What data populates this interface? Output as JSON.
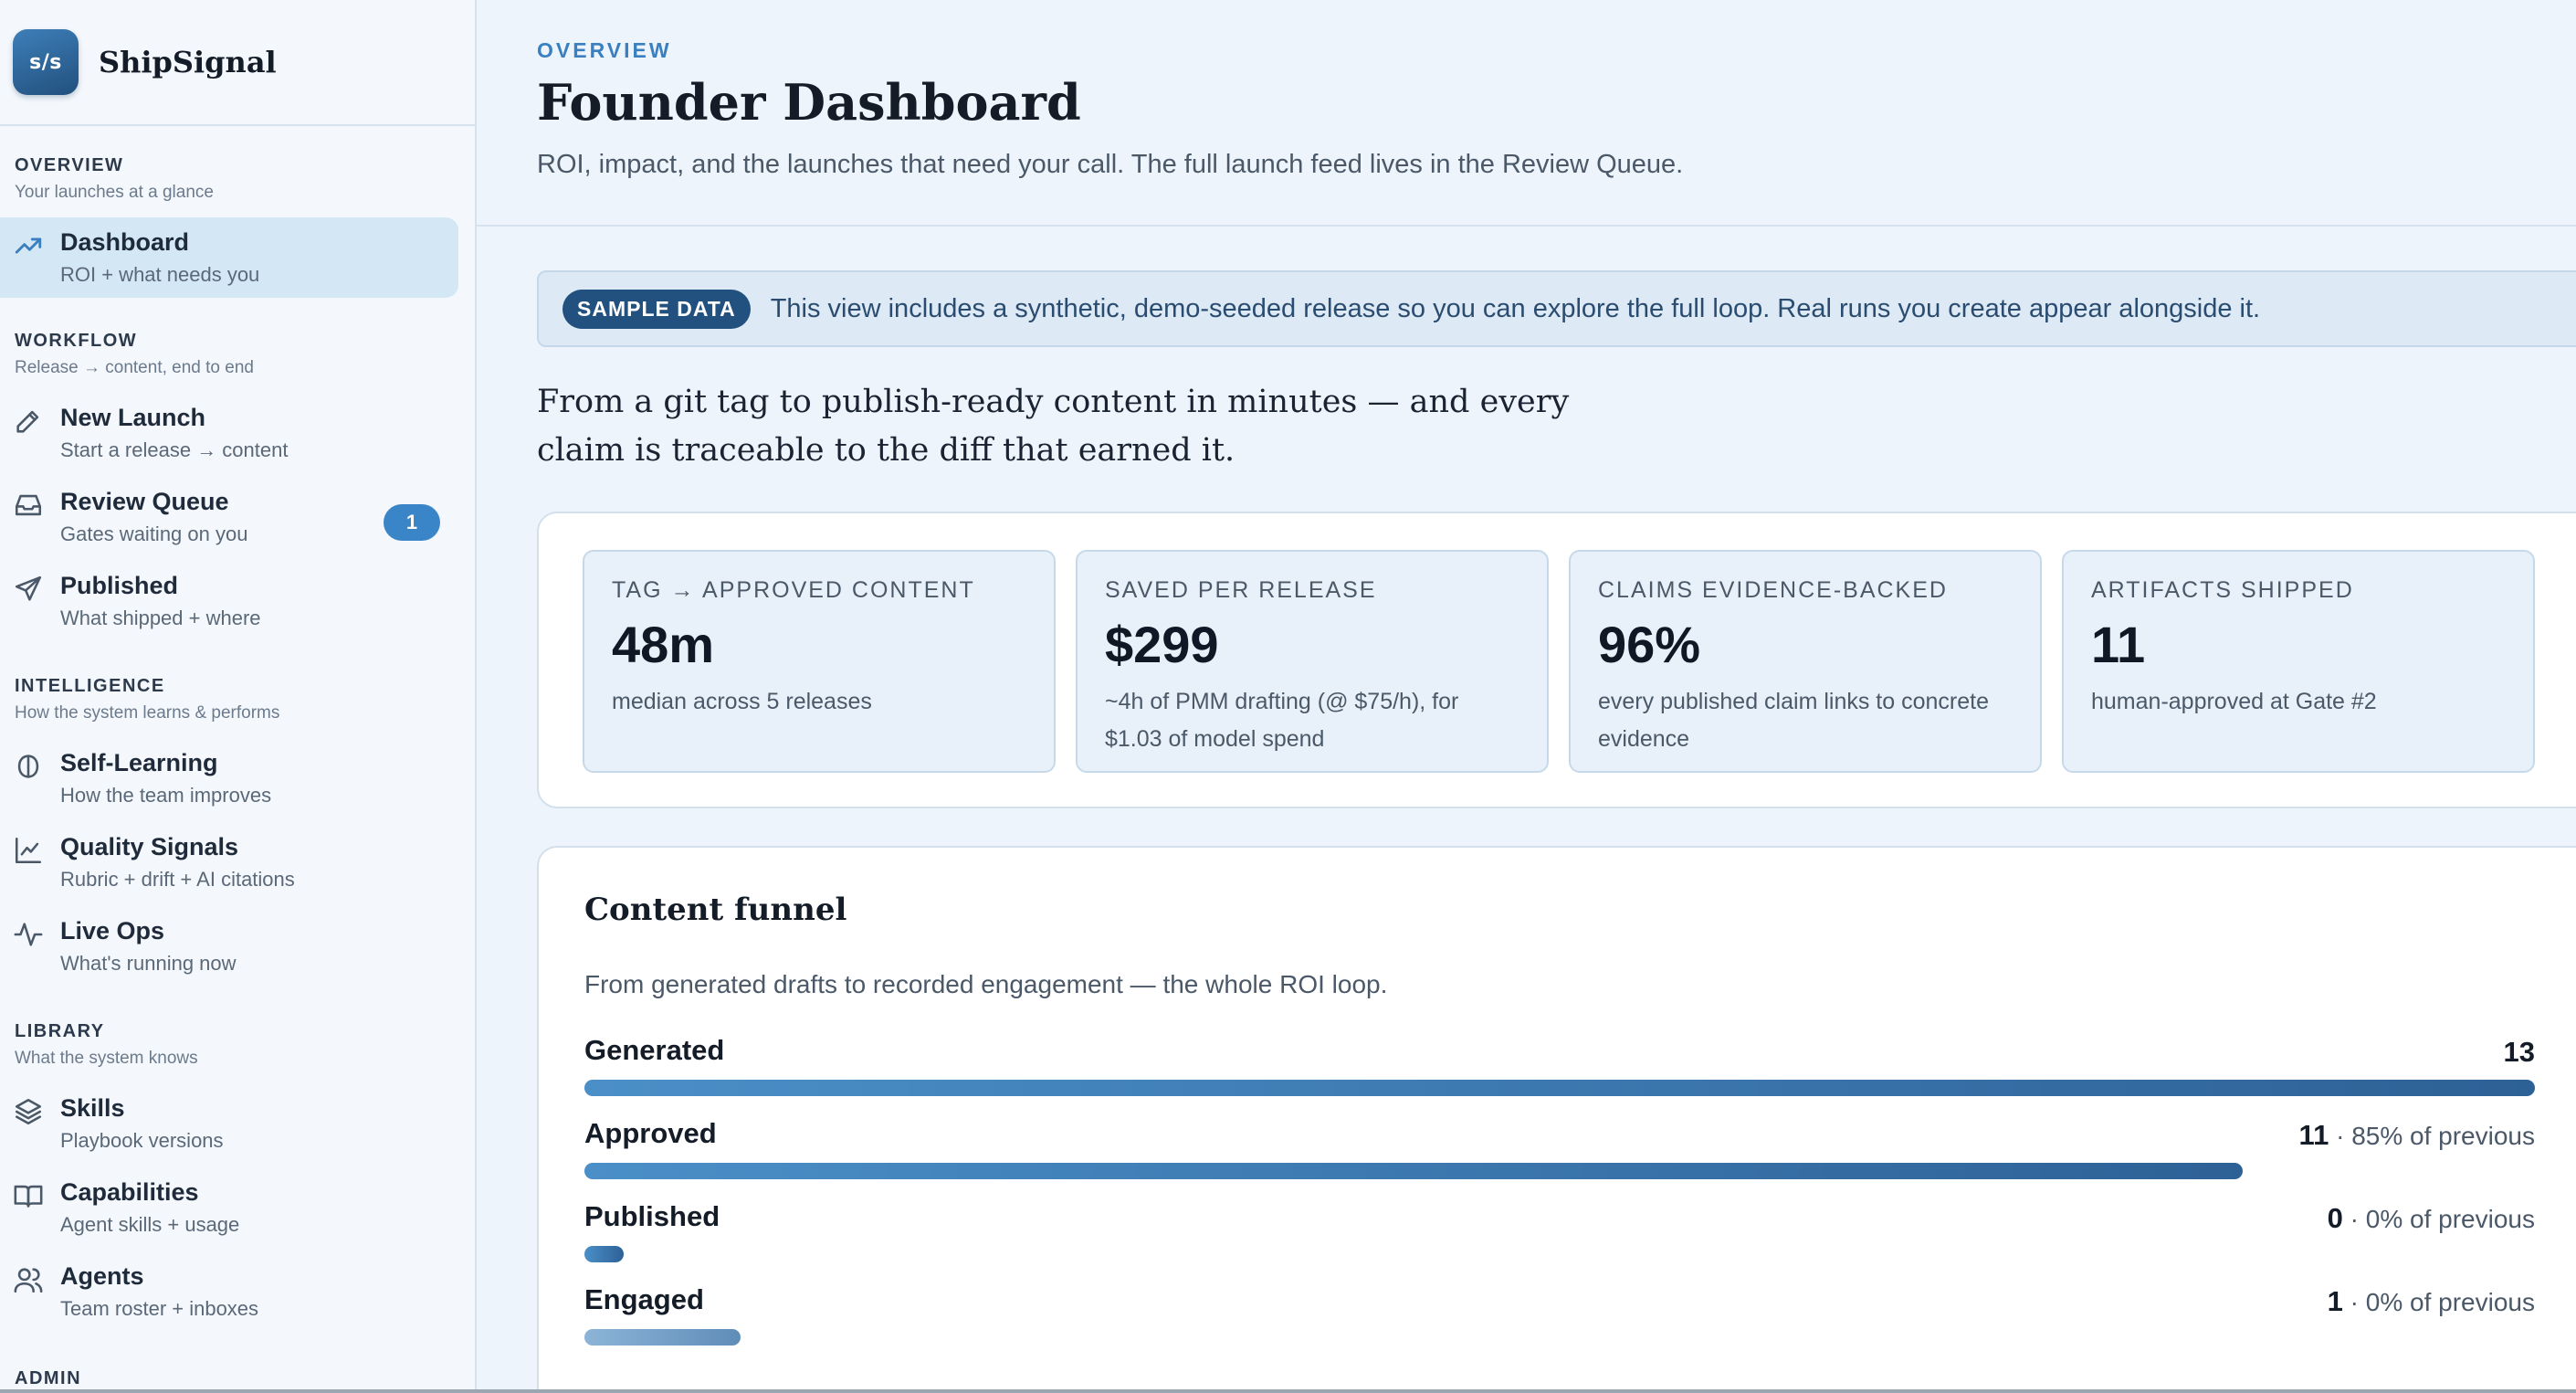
{
  "brand": {
    "logo_text": "s/s",
    "name": "ShipSignal"
  },
  "sidebar": {
    "sections": [
      {
        "title": "OVERVIEW",
        "subtitle": "Your launches at a glance"
      },
      {
        "title": "WORKFLOW",
        "subtitle": "Release → content, end to end"
      },
      {
        "title": "INTELLIGENCE",
        "subtitle": "How the system learns & performs"
      },
      {
        "title": "LIBRARY",
        "subtitle": "What the system knows"
      },
      {
        "title": "ADMIN"
      }
    ],
    "items": [
      {
        "label": "Dashboard",
        "desc": "ROI + what needs you",
        "icon": "trending-up-icon",
        "active": true
      },
      {
        "label": "New Launch",
        "desc": "Start a release → content",
        "icon": "pencil-icon"
      },
      {
        "label": "Review Queue",
        "desc": "Gates waiting on you",
        "icon": "inbox-icon",
        "badge": "1"
      },
      {
        "label": "Published",
        "desc": "What shipped + where",
        "icon": "send-icon"
      },
      {
        "label": "Self-Learning",
        "desc": "How the team improves",
        "icon": "brain-icon"
      },
      {
        "label": "Quality Signals",
        "desc": "Rubric + drift + AI citations",
        "icon": "line-chart-icon"
      },
      {
        "label": "Live Ops",
        "desc": "What's running now",
        "icon": "activity-icon"
      },
      {
        "label": "Skills",
        "desc": "Playbook versions",
        "icon": "layers-icon"
      },
      {
        "label": "Capabilities",
        "desc": "Agent skills + usage",
        "icon": "book-icon"
      },
      {
        "label": "Agents",
        "desc": "Team roster + inboxes",
        "icon": "users-icon"
      }
    ]
  },
  "header": {
    "eyebrow": "OVERVIEW",
    "title": "Founder Dashboard",
    "subtitle": "ROI, impact, and the launches that need your call. The full launch feed lives in the Review Queue."
  },
  "banner": {
    "pill": "SAMPLE DATA",
    "text": "This view includes a synthetic, demo-seeded release so you can explore the full loop. Real runs you create appear alongside it."
  },
  "tagline": "From a git tag to publish-ready content in minutes — and every claim is traceable to the diff that earned it.",
  "stats": [
    {
      "label": "TAG → APPROVED CONTENT",
      "value": "48m",
      "note": "median across 5 releases"
    },
    {
      "label": "SAVED PER RELEASE",
      "value": "$299",
      "note": "~4h of PMM drafting (@ $75/h), for $1.03 of model spend"
    },
    {
      "label": "CLAIMS EVIDENCE-BACKED",
      "value": "96%",
      "note": "every published claim links to concrete evidence"
    },
    {
      "label": "ARTIFACTS SHIPPED",
      "value": "11",
      "note": "human-approved at Gate #2"
    }
  ],
  "funnel": {
    "title": "Content funnel",
    "subtitle": "From generated drafts to recorded engagement — the whole ROI loop.",
    "rows": [
      {
        "name": "Generated",
        "count": "13",
        "suffix": "",
        "fill": 1.0
      },
      {
        "name": "Approved",
        "count": "11",
        "suffix": " · 85% of previous",
        "fill": 0.85
      },
      {
        "name": "Published",
        "count": "0",
        "suffix": " · 0% of previous",
        "fill": 0.02
      },
      {
        "name": "Engaged",
        "count": "1",
        "suffix": " · 0% of previous",
        "fill": 0.08,
        "light": true
      }
    ]
  },
  "colors": {
    "accent": "#3a84c8",
    "brand_dark": "#23517f",
    "active_bg": "#d3e7f5"
  }
}
